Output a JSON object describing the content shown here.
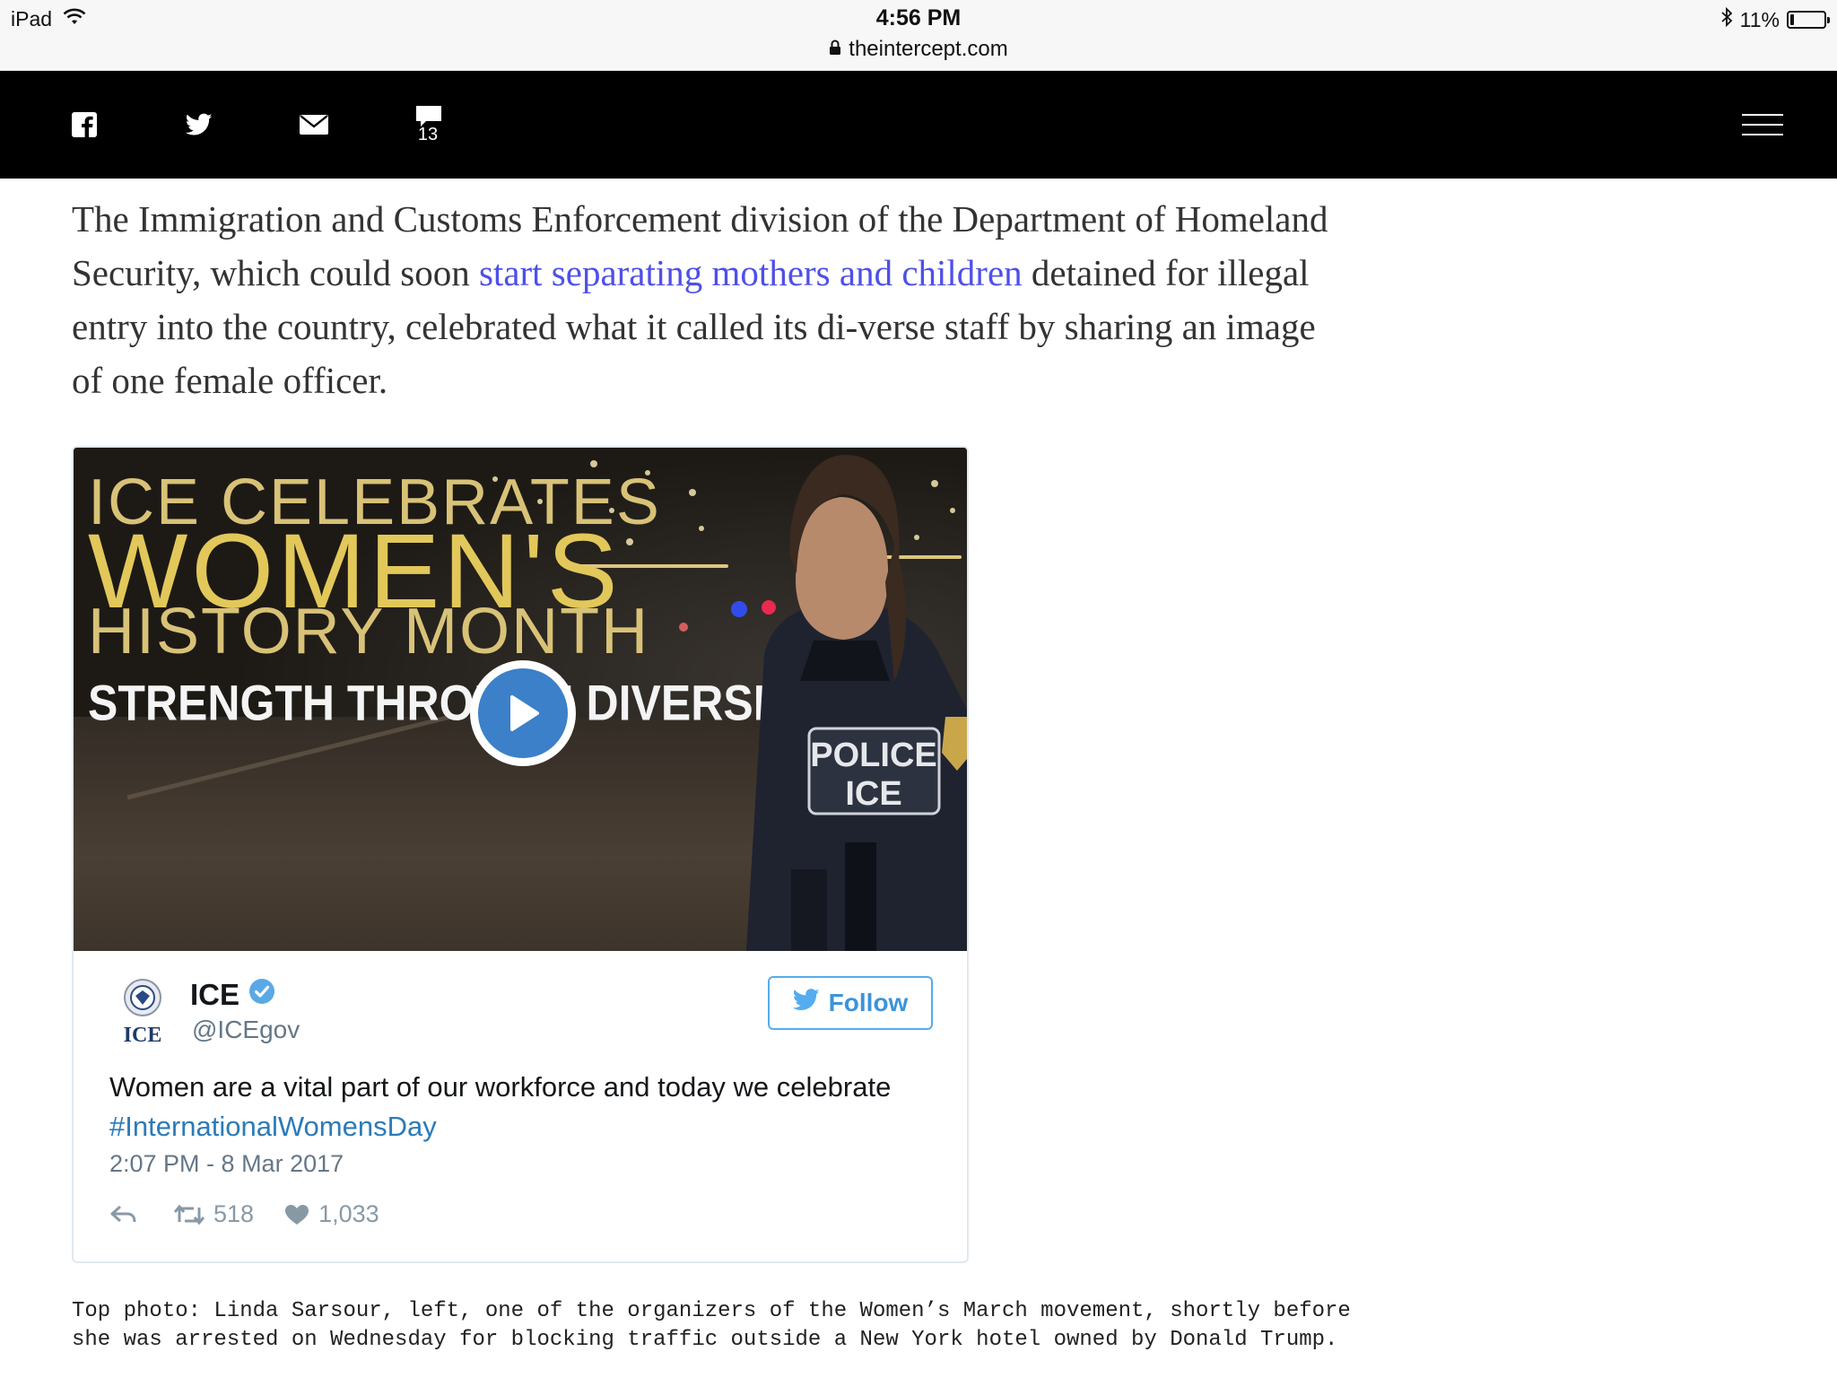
{
  "status_bar": {
    "device": "iPad",
    "time": "4:56 PM",
    "url": "theintercept.com",
    "battery": "11%",
    "battery_level": 0.11
  },
  "share_bar": {
    "comment_count": "13",
    "icons": [
      "facebook-icon",
      "twitter-icon",
      "email-icon",
      "comment-icon",
      "menu-icon"
    ]
  },
  "article": {
    "paragraph_before_link": "The Immigration and Customs Enforcement division of the Department of Homeland Security, which could soon ",
    "link_text": "start separating mothers and children",
    "paragraph_after_link": " detained for illegal entry into the country, celebrated what it called its di-verse staff by sharing an image of one female officer."
  },
  "tweet": {
    "media": {
      "title_line1": "ICE CELEBRATES",
      "title_line2": "WOMEN'S",
      "title_line3": "HISTORY MONTH",
      "title_line4": "STRENGTH THROUGH DIVERSITY",
      "vest_line1": "POLICE",
      "vest_line2": "ICE"
    },
    "account_logo_text": "ICE",
    "account_name": "ICE",
    "account_handle": "@ICEgov",
    "follow_label": "Follow",
    "text": "Women are a vital part of our workforce and today we celebrate",
    "hashtag": "#InternationalWomensDay",
    "timestamp": "2:07 PM - 8 Mar 2017",
    "retweets": "518",
    "likes": "1,033",
    "colors": {
      "accent": "#55acee",
      "hashtag": "#2b7bb9",
      "verified": "#1da1f2"
    }
  },
  "caption": "Top photo: Linda Sarsour, left, one of the organizers of the Women’s March movement, shortly before she was arrested on Wednesday for blocking traffic outside a New York hotel owned by Donald Trump.",
  "colors": {
    "link": "#4f50e8",
    "share_bar": "#000000"
  }
}
